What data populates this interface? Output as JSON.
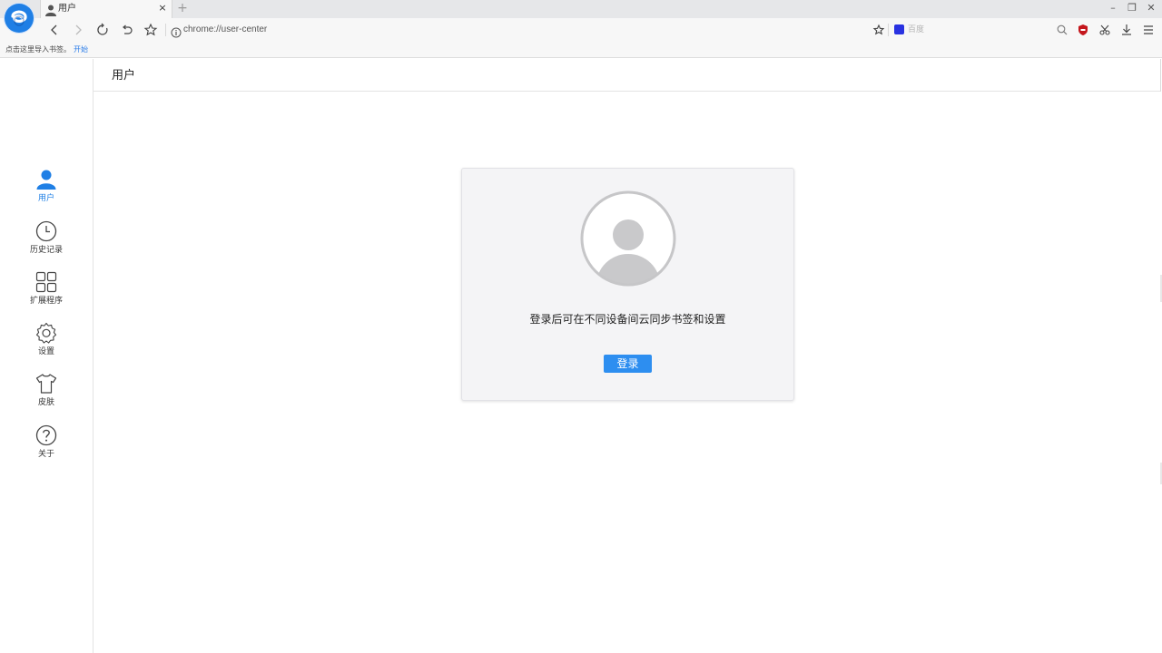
{
  "tab": {
    "title": "用户",
    "close_glyph": "×",
    "icon": "user-icon"
  },
  "new_tab_glyph": "+",
  "window_controls": {
    "minimize": "–",
    "restore": "❐",
    "close": "✕"
  },
  "address_bar": {
    "url": "chrome://user-center"
  },
  "search": {
    "placeholder": "百度",
    "engine": "baidu-icon"
  },
  "bookmark_bar": {
    "hint": "点击这里导入书签。",
    "start_link": "开始"
  },
  "sidebar": {
    "items": [
      {
        "label": "用户",
        "icon": "user-icon",
        "active": true
      },
      {
        "label": "历史记录",
        "icon": "clock-icon",
        "active": false
      },
      {
        "label": "扩展程序",
        "icon": "grid-icon",
        "active": false
      },
      {
        "label": "设置",
        "icon": "gear-icon",
        "active": false
      },
      {
        "label": "皮肤",
        "icon": "shirt-icon",
        "active": false
      },
      {
        "label": "关于",
        "icon": "question-icon",
        "active": false
      }
    ]
  },
  "page": {
    "title": "用户"
  },
  "login_card": {
    "message": "登录后可在不同设备间云同步书签和设置",
    "button_label": "登录"
  },
  "colors": {
    "accent": "#1f7fe5",
    "button": "#2d8ef0",
    "card_bg": "#f4f4f6"
  }
}
